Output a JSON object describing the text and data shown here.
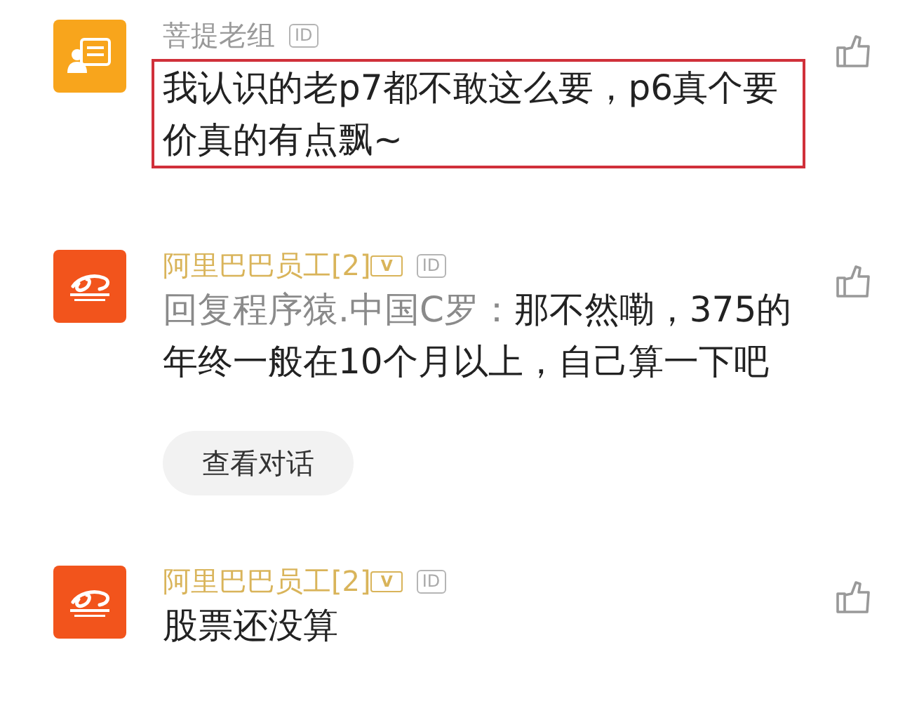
{
  "comments": [
    {
      "kind": "plain",
      "name": "菩提老组",
      "id_badge": "ID",
      "content": "我认识的老p7都不敢这么要，p6真个要价真的有点飘~",
      "highlighted": true
    },
    {
      "kind": "staff",
      "name": "阿里巴巴员工[2]",
      "level": "V",
      "id_badge": "ID",
      "reply_to": "回复程序猿.中国C罗：",
      "content": "那不然嘞，375的年终一般在10个月以上，自己算一下吧",
      "highlighted": false,
      "button": "查看对话"
    },
    {
      "kind": "staff",
      "name": "阿里巴巴员工[2]",
      "level": "V",
      "id_badge": "ID",
      "content": "股票还没算",
      "highlighted": false
    }
  ]
}
